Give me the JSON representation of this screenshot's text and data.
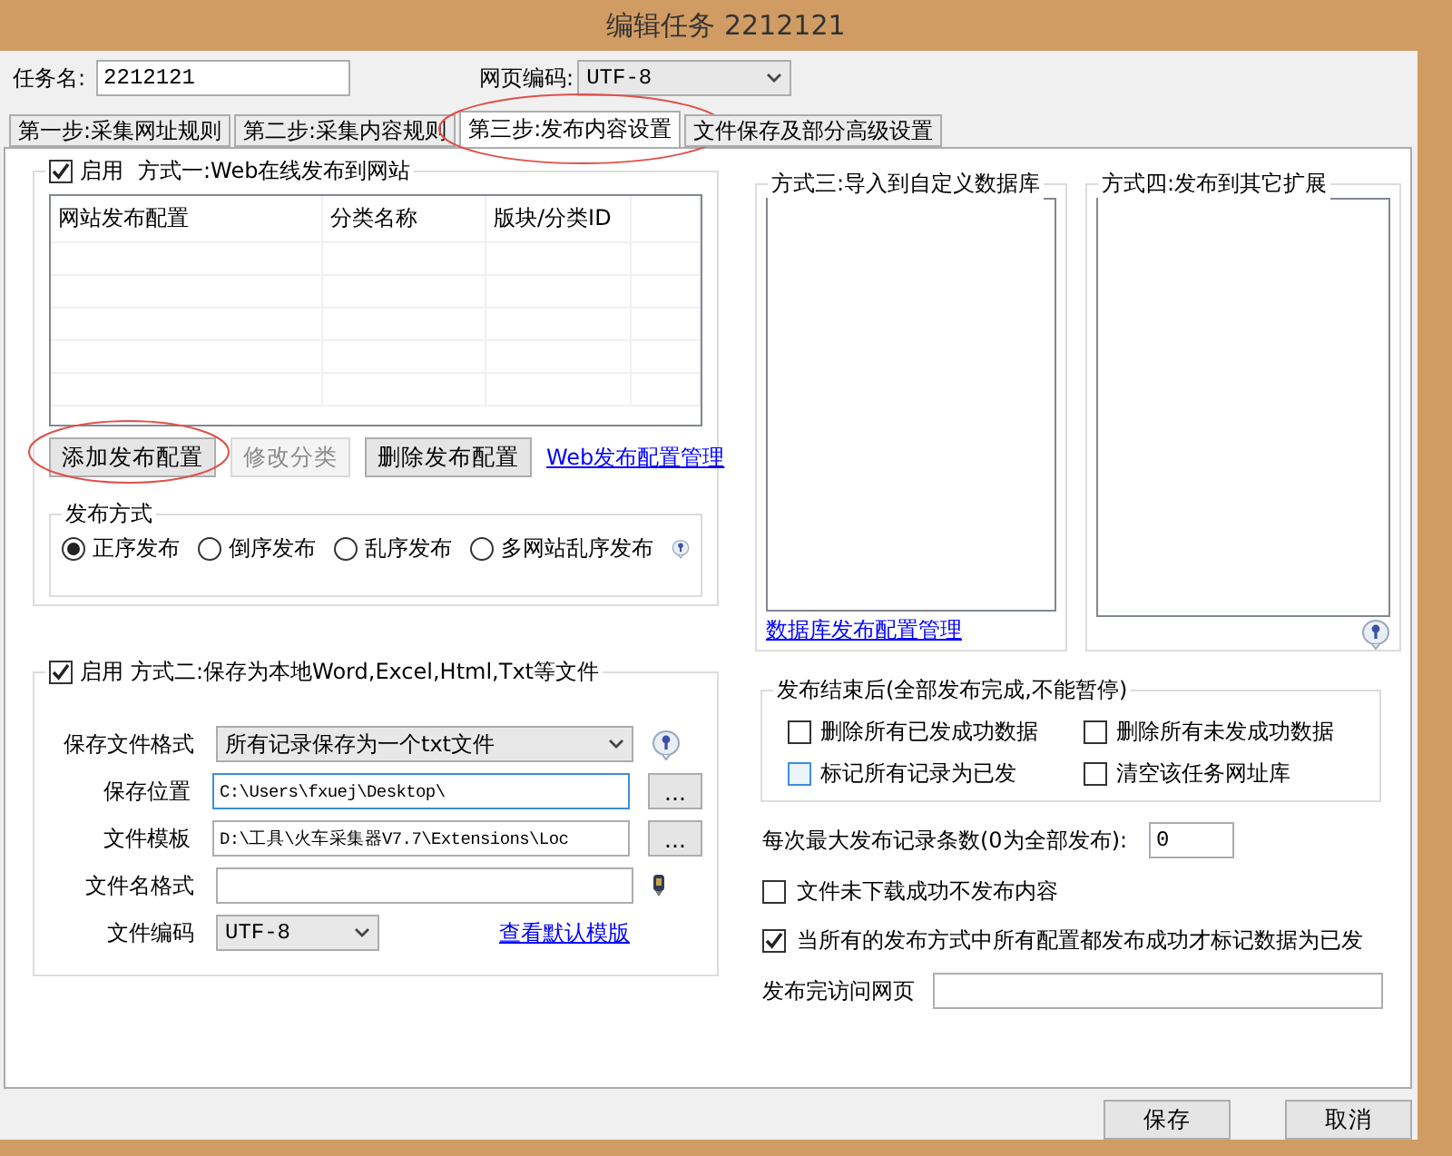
{
  "title": "编辑任务 2212121",
  "task_name": {
    "label": "任务名:",
    "value": "2212121"
  },
  "encoding": {
    "label": "网页编码:",
    "value": "UTF-8"
  },
  "tabs": [
    {
      "label": "第一步:采集网址规则",
      "selected": false,
      "annotated": false
    },
    {
      "label": "第二步:采集内容规则",
      "selected": false,
      "annotated": false
    },
    {
      "label": "第三步:发布内容设置",
      "selected": true,
      "annotated": true
    },
    {
      "label": "文件保存及部分高级设置",
      "selected": false,
      "annotated": false
    }
  ],
  "method1": {
    "enable_label": "启用",
    "checked": true,
    "title": "方式一:Web在线发布到网站",
    "columns": [
      "网站发布配置",
      "分类名称",
      "版块/分类ID"
    ],
    "buttons": [
      {
        "label": "添加发布配置",
        "disabled": false,
        "annotated": true
      },
      {
        "label": "修改分类",
        "disabled": true,
        "annotated": false
      },
      {
        "label": "删除发布配置",
        "disabled": false,
        "annotated": false
      }
    ],
    "link": "Web发布配置管理",
    "publish_mode": {
      "title": "发布方式",
      "options": [
        {
          "label": "正序发布",
          "selected": true
        },
        {
          "label": "倒序发布",
          "selected": false
        },
        {
          "label": "乱序发布",
          "selected": false
        },
        {
          "label": "多网站乱序发布",
          "selected": false
        }
      ]
    }
  },
  "method3": {
    "title": "方式三:导入到自定义数据库",
    "link": "数据库发布配置管理"
  },
  "method4": {
    "title": "方式四:发布到其它扩展"
  },
  "method2": {
    "enable_label": "启用",
    "checked": true,
    "title": "方式二:保存为本地Word,Excel,Html,Txt等文件",
    "fields": [
      {
        "kind": "select",
        "label": "保存文件格式",
        "value": "所有记录保存为一个txt文件"
      },
      {
        "kind": "path",
        "label": "保存位置",
        "value": "C:\\Users\\fxuej\\Desktop\\",
        "focused": true,
        "browse": "..."
      },
      {
        "kind": "path",
        "label": "文件模板",
        "value": "D:\\工具\\火车采集器V7.7\\Extensions\\Loc",
        "focused": false,
        "browse": "..."
      },
      {
        "kind": "name",
        "label": "文件名格式"
      },
      {
        "kind": "encoding",
        "label": "文件编码",
        "value": "UTF-8",
        "link": "查看默认模版"
      }
    ]
  },
  "after_publish": {
    "title": "发布结束后(全部发布完成,不能暂停)",
    "options": [
      {
        "label": "删除所有已发成功数据",
        "checked": false,
        "hovered": false
      },
      {
        "label": "删除所有未发成功数据",
        "checked": false,
        "hovered": false
      },
      {
        "label": "标记所有记录为已发",
        "checked": false,
        "hovered": true
      },
      {
        "label": "清空该任务网址库",
        "checked": false,
        "hovered": false
      }
    ]
  },
  "max_records": {
    "label": "每次最大发布记录条数(0为全部发布):",
    "value": "0"
  },
  "options": [
    {
      "label": "文件未下载成功不发布内容",
      "checked": false
    },
    {
      "label": "当所有的发布方式中所有配置都发布成功才标记数据为已发",
      "checked": true
    }
  ],
  "visit_page": {
    "label": "发布完访问网页"
  },
  "footer": [
    "保存",
    "取消"
  ]
}
